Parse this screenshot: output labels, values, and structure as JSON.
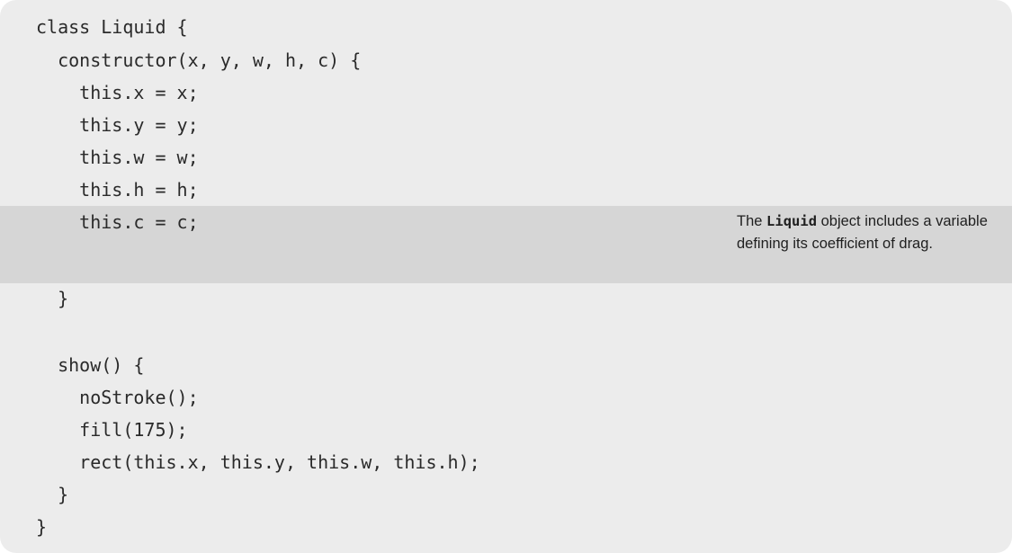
{
  "code": {
    "lines": [
      "class Liquid {",
      "  constructor(x, y, w, h, c) {",
      "    this.x = x;",
      "    this.y = y;",
      "    this.w = w;",
      "    this.h = h;",
      "    this.c = c;",
      "",
      "",
      "  }",
      "",
      "  show() {",
      "    noStroke();",
      "    fill(175);",
      "    rect(this.x, this.y, this.w, this.h);",
      "  }",
      "}"
    ],
    "highlighted_line_index": 6
  },
  "annotation": {
    "prefix": "The ",
    "code_term": "Liquid",
    "suffix": " object includes a variable defining its coefficient of drag."
  },
  "colors": {
    "card_background": "#ececec",
    "highlight_band": "#d6d6d6",
    "text": "#2a2a2a"
  }
}
